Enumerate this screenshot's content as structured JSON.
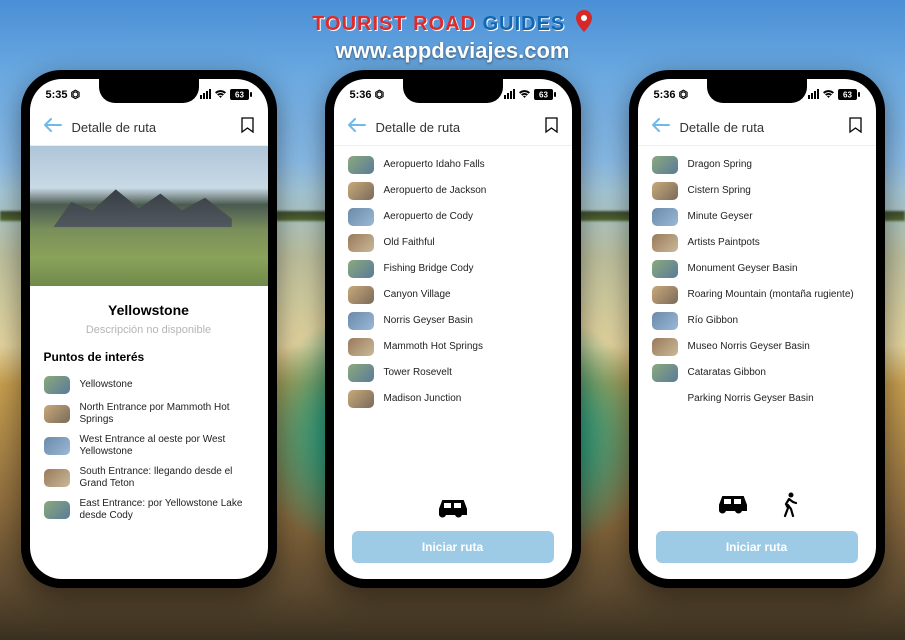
{
  "brand": {
    "word1": "TOURIST ROAD",
    "word2": "GUIDES",
    "url": "www.appdeviajes.com"
  },
  "status": {
    "time1": "5:35",
    "time2": "5:36",
    "time3": "5:36",
    "batt": "63"
  },
  "appbar": {
    "title": "Detalle de ruta"
  },
  "route": {
    "name": "Yellowstone",
    "subtitle": "Descripción no disponible",
    "section": "Puntos de interés"
  },
  "poi_a": [
    "Yellowstone",
    "North Entrance por Mammoth Hot Springs",
    "West Entrance al oeste por West Yellowstone",
    "South Entrance: llegando desde el Grand Teton",
    "East Entrance: por Yellowstone Lake desde Cody"
  ],
  "poi_b": [
    "Aeropuerto Idaho Falls",
    "Aeropuerto de Jackson",
    "Aeropuerto de Cody",
    "Old Faithful",
    "Fishing Bridge Cody",
    "Canyon Village",
    "Norris Geyser Basin",
    "Mammoth Hot Springs",
    "Tower Rosevelt",
    "Madison Junction"
  ],
  "poi_c": [
    "Dragon Spring",
    "Cistern Spring",
    "Minute Geyser",
    "Artists Paintpots",
    "Monument Geyser Basin",
    "Roaring Mountain (montaña rugiente)",
    "Río Gibbon",
    "Museo Norris Geyser Basin",
    "Cataratas Gibbon",
    "Parking Norris Geyser Basin"
  ],
  "cta": "Iniciar ruta"
}
